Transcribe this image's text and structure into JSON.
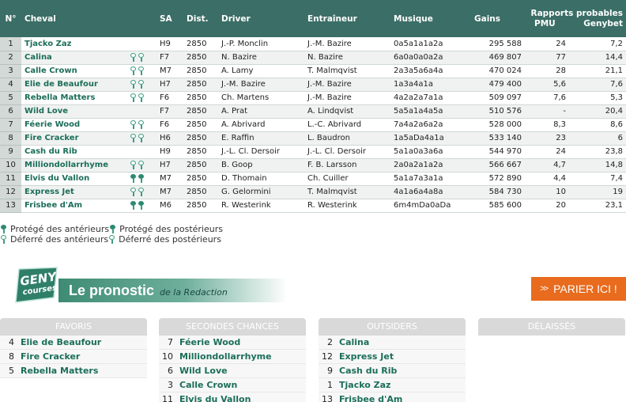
{
  "table": {
    "headers": {
      "num": "N°",
      "horse": "Cheval",
      "sa": "SA",
      "dist": "Dist.",
      "driver": "Driver",
      "trainer": "Entraîneur",
      "music": "Musique",
      "gains": "Gains",
      "rapports": "Rapports probables",
      "pmu": "PMU",
      "genybet": "Genybet"
    },
    "rows": [
      {
        "num": "1",
        "horse": "Tjacko Zaz",
        "shoe": "",
        "sa": "H9",
        "dist": "2850",
        "driver": "J.-P. Monclin",
        "trainer": "J.-M. Bazire",
        "music": "0a5a1a1a2a",
        "gains": "295 588",
        "pmu": "24",
        "genybet": "7,2"
      },
      {
        "num": "2",
        "horse": "Calina",
        "shoe": "DA",
        "sa": "F7",
        "dist": "2850",
        "driver": "N. Bazire",
        "trainer": "N. Bazire",
        "music": "6a0a0a0a2a",
        "gains": "469 807",
        "pmu": "77",
        "genybet": "14,4"
      },
      {
        "num": "3",
        "horse": "Calle Crown",
        "shoe": "DA",
        "sa": "M7",
        "dist": "2850",
        "driver": "A. Lamy",
        "trainer": "T. Malmqvist",
        "music": "2a3a5a6a4a",
        "gains": "470 024",
        "pmu": "28",
        "genybet": "21,1"
      },
      {
        "num": "4",
        "horse": "Elie de Beaufour",
        "shoe": "DA",
        "sa": "H7",
        "dist": "2850",
        "driver": "J.-M. Bazire",
        "trainer": "J.-M. Bazire",
        "music": "1a3a4a1a",
        "gains": "479 400",
        "pmu": "5,6",
        "genybet": "7,6"
      },
      {
        "num": "5",
        "horse": "Rebella Matters",
        "shoe": "DA",
        "sa": "F6",
        "dist": "2850",
        "driver": "Ch. Martens",
        "trainer": "J.-M. Bazire",
        "music": "4a2a2a7a1a",
        "gains": "509 097",
        "pmu": "7,6",
        "genybet": "5,3"
      },
      {
        "num": "6",
        "horse": "Wild Love",
        "shoe": "",
        "sa": "F7",
        "dist": "2850",
        "driver": "A. Prat",
        "trainer": "A. Lindqvist",
        "music": "5a5a1a4a5a",
        "gains": "510 576",
        "pmu": "-",
        "genybet": "20,4"
      },
      {
        "num": "7",
        "horse": "Féerie Wood",
        "shoe": "DA",
        "sa": "F6",
        "dist": "2850",
        "driver": "A. Abrivard",
        "trainer": "L.-C. Abrivard",
        "music": "7a4a2a6a2a",
        "gains": "528 000",
        "pmu": "8,3",
        "genybet": "8,6"
      },
      {
        "num": "8",
        "horse": "Fire Cracker",
        "shoe": "DA",
        "sa": "H6",
        "dist": "2850",
        "driver": "E. Raffin",
        "trainer": "L. Baudron",
        "music": "1a5aDa4a1a",
        "gains": "533 140",
        "pmu": "23",
        "genybet": "6"
      },
      {
        "num": "9",
        "horse": "Cash du Rib",
        "shoe": "",
        "sa": "H9",
        "dist": "2850",
        "driver": "J.-L. Cl. Dersoir",
        "trainer": "J.-L. Cl. Dersoir",
        "music": "5a1a0a3a6a",
        "gains": "544 970",
        "pmu": "24",
        "genybet": "23,8"
      },
      {
        "num": "10",
        "horse": "Milliondollarrhyme",
        "shoe": "DA",
        "sa": "H7",
        "dist": "2850",
        "driver": "B. Goop",
        "trainer": "F. B. Larsson",
        "music": "2a0a2a1a2a",
        "gains": "566 667",
        "pmu": "4,7",
        "genybet": "14,8"
      },
      {
        "num": "11",
        "horse": "Elvis du Vallon",
        "shoe": "D4",
        "sa": "M7",
        "dist": "2850",
        "driver": "D. Thomain",
        "trainer": "Ch. Cuiller",
        "music": "5a1a7a3a1a",
        "gains": "572 890",
        "pmu": "4,4",
        "genybet": "7,4"
      },
      {
        "num": "12",
        "horse": "Express Jet",
        "shoe": "DA",
        "sa": "M7",
        "dist": "2850",
        "driver": "G. Gelormini",
        "trainer": "T. Malmqvist",
        "music": "4a1a6a4a8a",
        "gains": "584 730",
        "pmu": "10",
        "genybet": "19"
      },
      {
        "num": "13",
        "horse": "Frisbee d'Am",
        "shoe": "D4",
        "sa": "M6",
        "dist": "2850",
        "driver": "R. Westerink",
        "trainer": "R. Westerink",
        "music": "6m4mDa0aDa",
        "gains": "585 600",
        "pmu": "20",
        "genybet": "23,1"
      }
    ]
  },
  "legend": {
    "items": [
      "Protégé des antérieurs",
      "Protégé des postérieurs",
      "Déferré des antérieurs",
      "Déferré des postérieurs"
    ]
  },
  "pronostic": {
    "logo_line1": "GENY",
    "logo_line2": "courses",
    "title": "Le pronostic",
    "subtitle": "de la Redaction",
    "bet_button": "PARIER ICI !",
    "categories": [
      {
        "label": "FAVORIS",
        "items": [
          {
            "num": "4",
            "name": "Elie de Beaufour"
          },
          {
            "num": "8",
            "name": "Fire Cracker"
          },
          {
            "num": "5",
            "name": "Rebella Matters"
          }
        ]
      },
      {
        "label": "SECONDES CHANCES",
        "items": [
          {
            "num": "7",
            "name": "Féerie Wood"
          },
          {
            "num": "10",
            "name": "Milliondollarrhyme"
          },
          {
            "num": "6",
            "name": "Wild Love"
          },
          {
            "num": "3",
            "name": "Calle Crown"
          },
          {
            "num": "11",
            "name": "Elvis du Vallon"
          }
        ]
      },
      {
        "label": "OUTSIDERS",
        "items": [
          {
            "num": "2",
            "name": "Calina"
          },
          {
            "num": "12",
            "name": "Express Jet"
          },
          {
            "num": "9",
            "name": "Cash du Rib"
          },
          {
            "num": "1",
            "name": "Tjacko Zaz"
          },
          {
            "num": "13",
            "name": "Frisbee d'Am"
          }
        ]
      },
      {
        "label": "DÉLAISSÉS",
        "items": []
      }
    ]
  },
  "colors": {
    "header_bg": "#3b6e66",
    "horse_name": "#1b6e59",
    "bet_button": "#e96b1d"
  }
}
